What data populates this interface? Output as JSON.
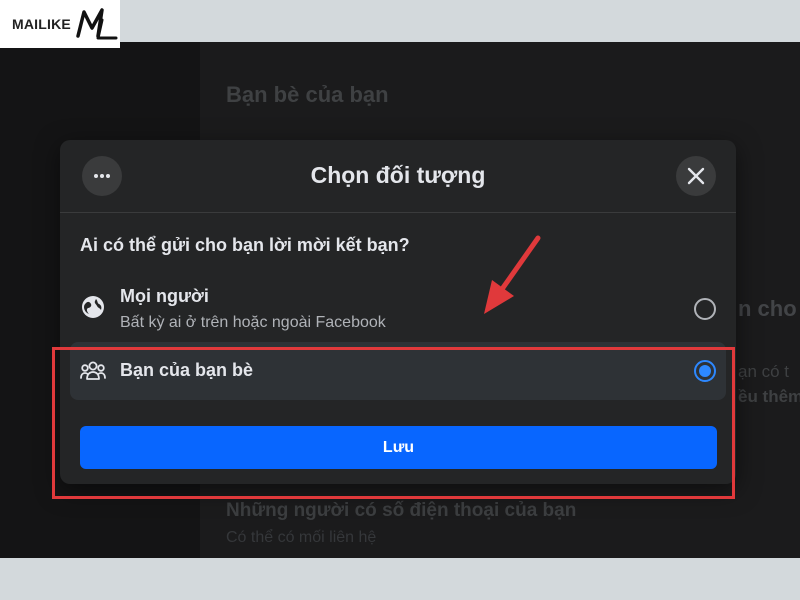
{
  "watermark": {
    "text": "MAILIKE",
    "mark": "ML"
  },
  "background": {
    "heading": "Bạn bè của bạn",
    "right_fragment_1": "n cho a",
    "right_fragment_2": "ạn có t",
    "right_fragment_3": "ều thêm",
    "bottom_title": "Những người có số điện thoại của bạn",
    "bottom_subtitle": "Có thể có mối liên hệ"
  },
  "modal": {
    "title": "Chọn đối tượng",
    "question": "Ai có thể gửi cho bạn lời mời kết bạn?",
    "options": [
      {
        "title": "Mọi người",
        "description": "Bất kỳ ai ở trên hoặc ngoài Facebook",
        "icon": "globe-icon",
        "selected": false
      },
      {
        "title": "Bạn của bạn bè",
        "icon": "friends-icon",
        "selected": true
      }
    ],
    "save_label": "Lưu"
  },
  "colors": {
    "accent": "#0866ff",
    "radio_selected": "#2d88ff",
    "annotation": "#e0393b",
    "modal_bg": "#242526"
  }
}
